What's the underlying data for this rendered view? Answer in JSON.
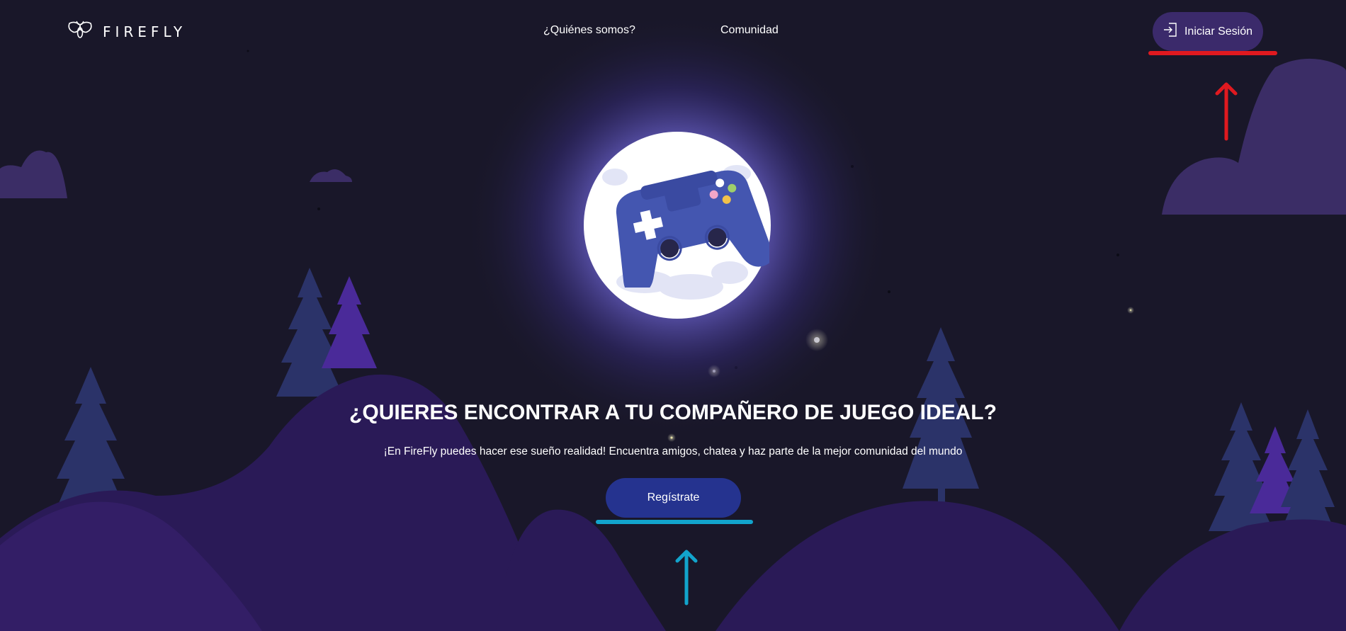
{
  "brand": {
    "name": "FIREFLY",
    "icon": "firefly-logo-icon"
  },
  "nav": {
    "items": [
      "¿Quiénes somos?",
      "Comunidad"
    ]
  },
  "login": {
    "label": "Iniciar Sesión",
    "icon": "login-icon"
  },
  "hero": {
    "title": "¿QUIERES ENCONTRAR A TU COMPAÑERO DE JUEGO IDEAL?",
    "subtitle": "¡En FireFly puedes hacer ese sueño realidad! Encuentra amigos, chatea y haz parte de la mejor comunidad del mundo",
    "cta_label": "Regístrate",
    "illustration_icon": "gamepad-moon-icon"
  },
  "annotations": {
    "login_color": "#e0191f",
    "register_color": "#12a4cc"
  },
  "colors": {
    "background": "#191729",
    "hills": [
      "#2a1a57",
      "#331e66"
    ],
    "clouds": "#3b2d66",
    "trees": [
      "#2b3369",
      "#4a2a99"
    ],
    "login_button": "#3b2a6b",
    "register_button": "#25338f",
    "controller": "#4456b0"
  }
}
